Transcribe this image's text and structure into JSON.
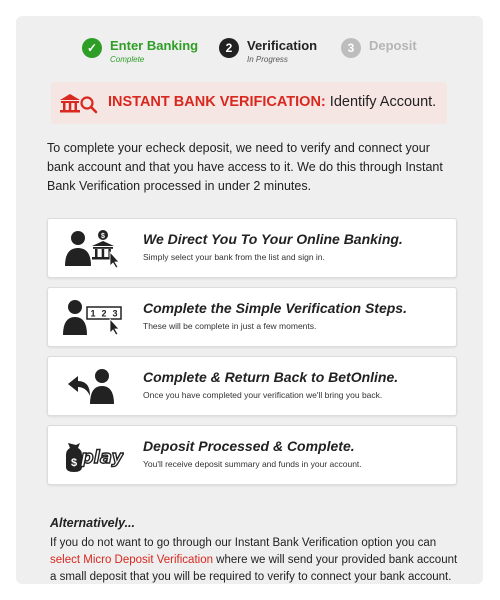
{
  "stepper": {
    "steps": [
      {
        "marker": "✓",
        "title": "Enter Banking",
        "subtitle": "Complete",
        "status_color": "#2f9e27"
      },
      {
        "marker": "2",
        "title": "Verification",
        "subtitle": "In Progress",
        "status_color": "#222222"
      },
      {
        "marker": "3",
        "title": "Deposit",
        "subtitle": "",
        "status_color": "#bdbdbd"
      }
    ]
  },
  "banner": {
    "strong": "INSTANT BANK VERIFICATION:",
    "rest": " Identify Account.",
    "icon": "bank-search-icon",
    "accent_color": "#d8281f"
  },
  "intro": "To complete your echeck deposit, we need to verify and connect your bank account and that you have access to it. We do this through Instant Bank Verification processed in under 2 minutes.",
  "cards": [
    {
      "icon": "person-bank-icon",
      "title": "We Direct You To Your Online Banking.",
      "desc": "Simply select your bank from the list and sign in."
    },
    {
      "icon": "person-steps-icon",
      "title": "Complete the Simple Verification Steps.",
      "desc": "These will be complete in just a few moments."
    },
    {
      "icon": "return-person-icon",
      "title": "Complete & Return Back to BetOnline.",
      "desc": "Once you have completed your verification we'll bring you back."
    },
    {
      "icon": "money-play-icon",
      "title": "Deposit Processed & Complete.",
      "desc": "You'll receive deposit summary and funds in your account."
    }
  ],
  "alternative": {
    "title": "Alternatively...",
    "text_before": "If you do not want to go through our Instant Bank Verification option you can ",
    "link": "select Micro Deposit Verification",
    "text_after": " where we will send your provided bank account a small deposit that you will be required to verify to connect your bank account. This pro-"
  }
}
